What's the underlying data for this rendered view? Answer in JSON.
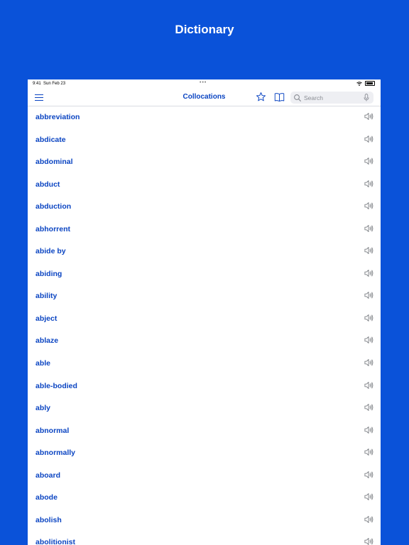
{
  "hero": {
    "title": "Dictionary"
  },
  "status_bar": {
    "time": "9:41",
    "date": "Sun Feb 23",
    "dots": "•••"
  },
  "nav": {
    "title": "Collocations",
    "search_placeholder": "Search"
  },
  "icons": {
    "menu": "hamburger-menu-icon",
    "favorite": "star-icon",
    "book": "book-icon",
    "search": "magnifier-icon",
    "mic": "microphone-icon",
    "speaker": "speaker-icon"
  },
  "colors": {
    "brand": "#0a52d9",
    "word": "#0a44c2"
  },
  "words": [
    "abbreviation",
    "abdicate",
    "abdominal",
    "abduct",
    "abduction",
    "abhorrent",
    "abide by",
    "abiding",
    "ability",
    "abject",
    "ablaze",
    "able",
    "able-bodied",
    "ably",
    "abnormal",
    "abnormally",
    "aboard",
    "abode",
    "abolish",
    "abolitionist"
  ]
}
